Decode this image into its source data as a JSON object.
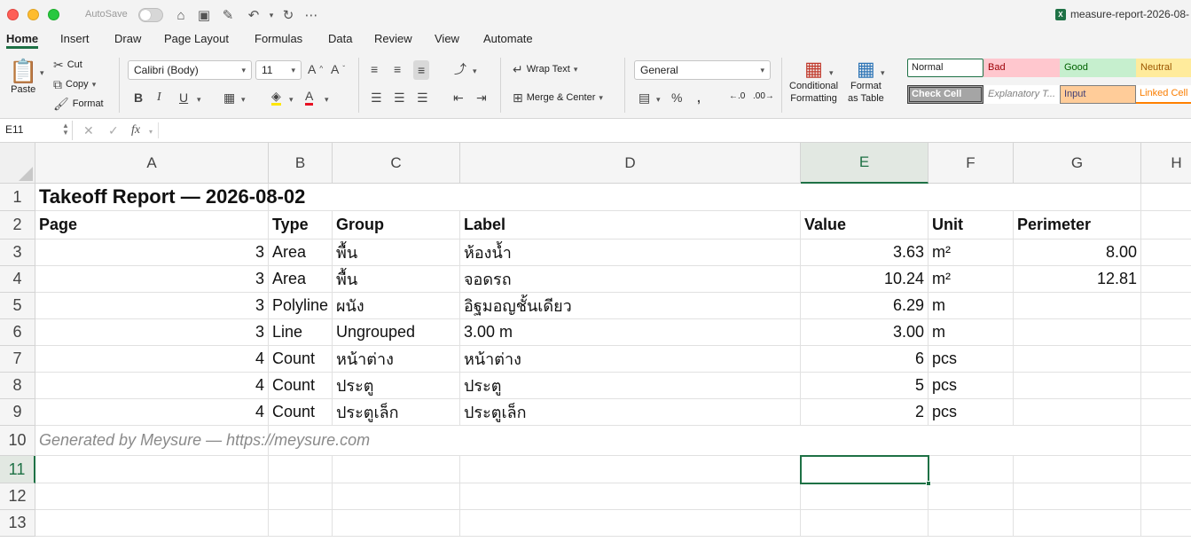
{
  "titlebar": {
    "autosave_label": "AutoSave",
    "file_title": "measure-report-2026-08-"
  },
  "tabs": [
    "Home",
    "Insert",
    "Draw",
    "Page Layout",
    "Formulas",
    "Data",
    "Review",
    "View",
    "Automate"
  ],
  "ribbon": {
    "paste": "Paste",
    "cut": "Cut",
    "copy": "Copy",
    "format": "Format",
    "font_name": "Calibri (Body)",
    "font_size": "11",
    "wrap_text": "Wrap Text",
    "merge_center": "Merge & Center",
    "number_format": "General",
    "conditional_formatting": [
      "Conditional",
      "Formatting"
    ],
    "format_as_table": [
      "Format",
      "as Table"
    ],
    "styles": [
      {
        "label": "Normal",
        "bg": "#ffffff",
        "color": "#222222",
        "border": "#1e7145"
      },
      {
        "label": "Bad",
        "bg": "#ffc7ce",
        "color": "#9c0006",
        "border": "#ffc7ce"
      },
      {
        "label": "Good",
        "bg": "#c6efce",
        "color": "#006100",
        "border": "#c6efce"
      },
      {
        "label": "Neutral",
        "bg": "#ffeb9c",
        "color": "#9c5700",
        "border": "#ffeb9c"
      },
      {
        "label": "Check Cell",
        "bg": "#a5a5a5",
        "color": "#ffffff",
        "border": "#3f3f3f"
      },
      {
        "label": "Explanatory T...",
        "bg": "#ffffff",
        "color": "#7f7f7f",
        "border": "#ffffff"
      },
      {
        "label": "Input",
        "bg": "#ffcc99",
        "color": "#3f3f76",
        "border": "#7f7f7f"
      },
      {
        "label": "Linked Cell",
        "bg": "#ffffff",
        "color": "#fa7d00",
        "border": "#ff8001"
      }
    ]
  },
  "formula_bar": {
    "name_box": "E11",
    "fx": "fx",
    "content": ""
  },
  "columns": [
    "A",
    "B",
    "C",
    "D",
    "E",
    "F",
    "G",
    "H"
  ],
  "rows": [
    "1",
    "2",
    "3",
    "4",
    "5",
    "6",
    "7",
    "8",
    "9",
    "10",
    "11",
    "12",
    "13"
  ],
  "sheet": {
    "title": "Takeoff Report — 2026-08-02",
    "headers": [
      "Page",
      "Type",
      "Group",
      "Label",
      "Value",
      "Unit",
      "Perimeter"
    ],
    "data": [
      [
        "3",
        "Area",
        "พื้น",
        "ห้องน้ำ",
        "3.63",
        "m²",
        "8.00"
      ],
      [
        "3",
        "Area",
        "พื้น",
        "จอดรถ",
        "10.24",
        "m²",
        "12.81"
      ],
      [
        "3",
        "Polyline",
        "ผนัง",
        "อิฐมอญชั้นเดียว",
        "6.29",
        "m",
        ""
      ],
      [
        "3",
        "Line",
        "Ungrouped",
        "3.00 m",
        "3.00",
        "m",
        ""
      ],
      [
        "4",
        "Count",
        "หน้าต่าง",
        "หน้าต่าง",
        "6",
        "pcs",
        ""
      ],
      [
        "4",
        "Count",
        "ประตู",
        "ประตู",
        "5",
        "pcs",
        ""
      ],
      [
        "4",
        "Count",
        "ประตูเล็ก",
        "ประตูเล็ก",
        "2",
        "pcs",
        ""
      ]
    ],
    "footer": "Generated by Meysure — https://meysure.com"
  },
  "selected_cell": "E11"
}
